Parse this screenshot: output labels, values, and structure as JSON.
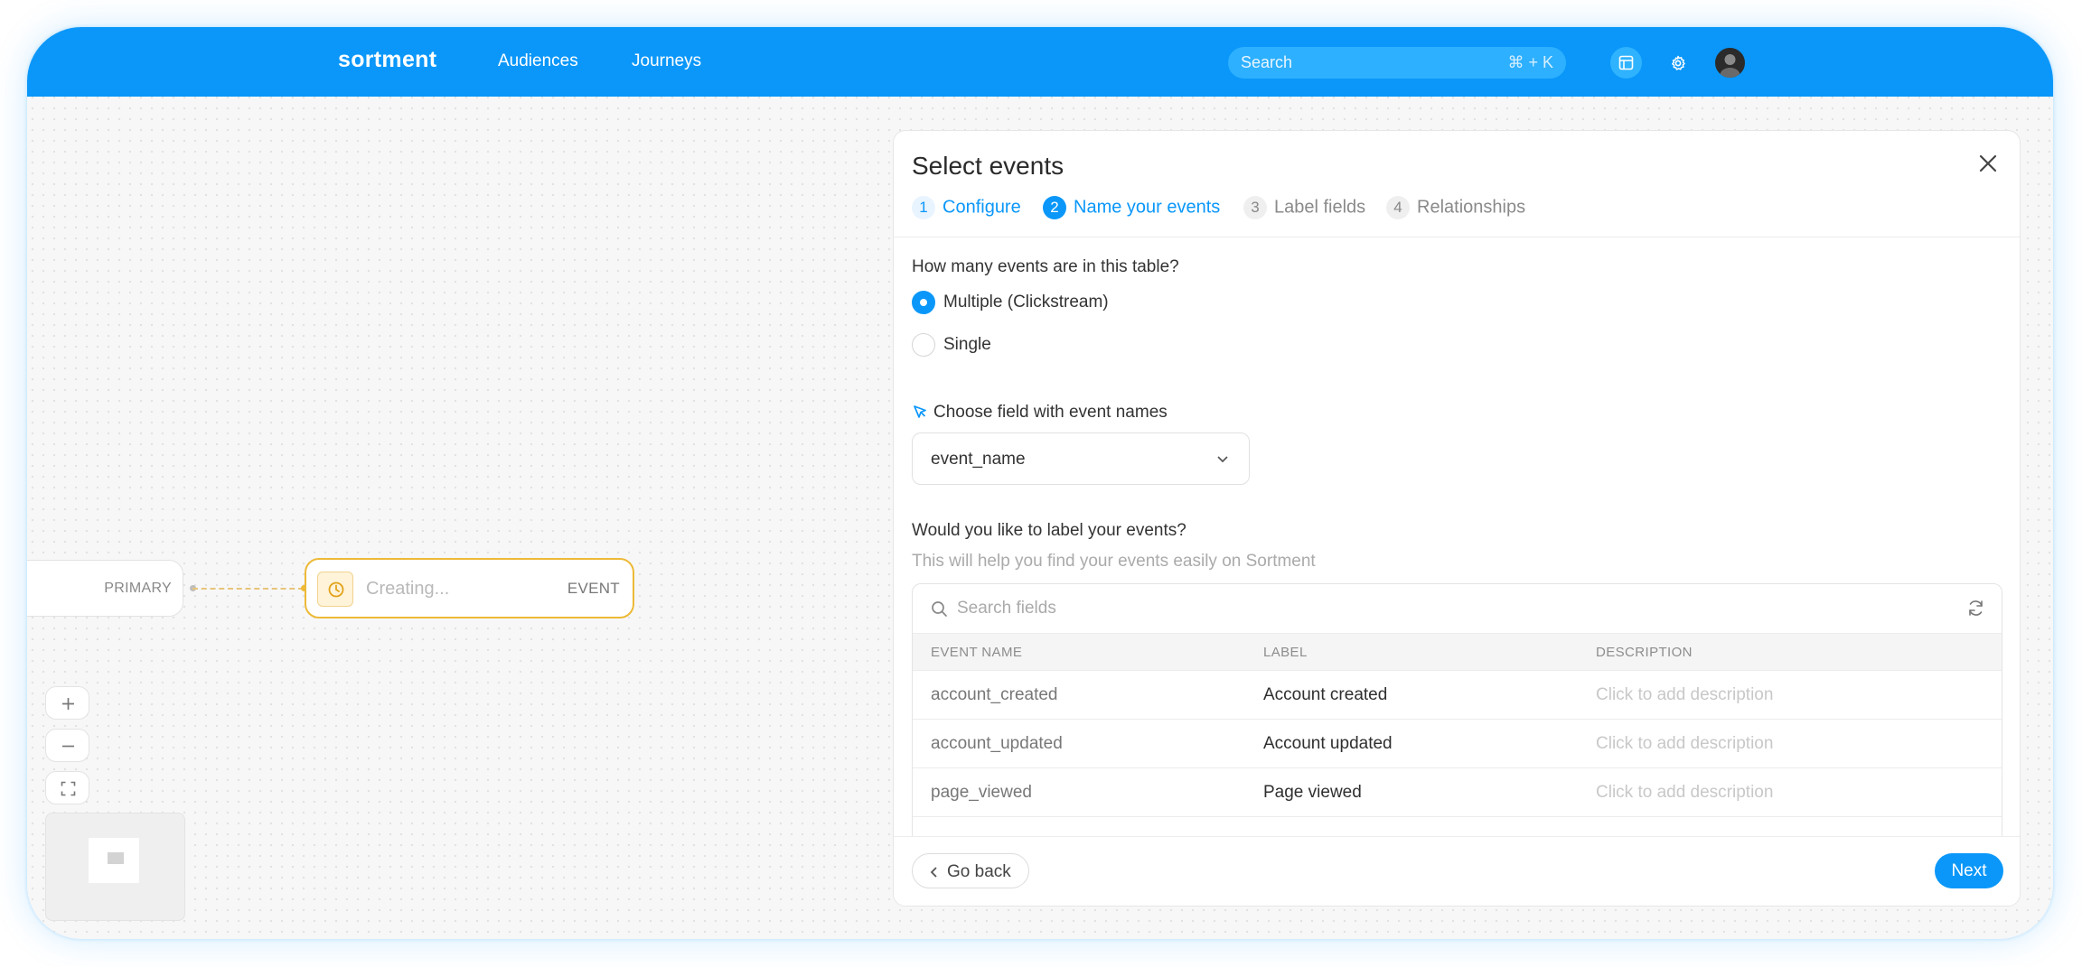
{
  "app": {
    "logo": "sortment"
  },
  "nav": [
    {
      "label": "Audiences"
    },
    {
      "label": "Journeys"
    }
  ],
  "search": {
    "placeholder": "Search",
    "shortcut": "⌘ + K"
  },
  "canvas": {
    "primary_node": {
      "tag": "PRIMARY"
    },
    "event_node": {
      "status": "Creating...",
      "tag": "EVENT"
    },
    "colors": {
      "edge": "#e8c47a",
      "event_border": "#edb937"
    }
  },
  "panel": {
    "title": "Select events",
    "steps": [
      {
        "num": "1",
        "label": "Configure",
        "state": "done"
      },
      {
        "num": "2",
        "label": "Name your events",
        "state": "active"
      },
      {
        "num": "3",
        "label": "Label fields",
        "state": "todo"
      },
      {
        "num": "4",
        "label": "Relationships",
        "state": "todo"
      }
    ],
    "question_count": "How many events are in this table?",
    "options": [
      {
        "label": "Multiple (Clickstream)",
        "selected": true
      },
      {
        "label": "Single",
        "selected": false
      }
    ],
    "field_label": "Choose field with event names",
    "field_value": "event_name",
    "label_question": "Would you like to label your events?",
    "label_hint": "This will help you find your events easily on Sortment",
    "table": {
      "search_placeholder": "Search fields",
      "columns": [
        "EVENT NAME",
        "LABEL",
        "DESCRIPTION"
      ],
      "rows": [
        {
          "event": "account_created",
          "label": "Account created",
          "description": "Click to add description"
        },
        {
          "event": "account_updated",
          "label": "Account updated",
          "description": "Click to add description"
        },
        {
          "event": "page_viewed",
          "label": "Page viewed",
          "description": "Click to add description"
        }
      ]
    },
    "back_label": "Go back",
    "next_label": "Next"
  },
  "colors": {
    "brand": "#0a97f9",
    "accent_warning": "#edb937"
  }
}
